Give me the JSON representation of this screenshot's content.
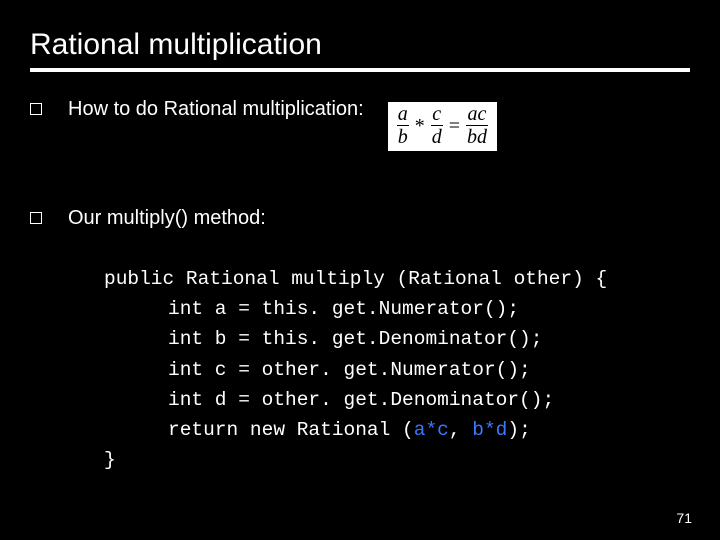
{
  "title": "Rational multiplication",
  "bullets": [
    "How to do Rational multiplication:",
    "Our multiply() method:"
  ],
  "formula": {
    "frac1_num": "a",
    "frac1_den": "b",
    "op1": "*",
    "frac2_num": "c",
    "frac2_den": "d",
    "op2": "=",
    "frac3_num": "ac",
    "frac3_den": "bd"
  },
  "code": {
    "l1a": "public Rational multiply (Rational other) {",
    "l2a": "int a = this. get.Numerator();",
    "l3a": "int b = this. get.Denominator();",
    "l4a": "int c = other. get.Numerator();",
    "l5a": "int d = other. get.Denominator();",
    "l6a": "return new Rational (",
    "l6b": "a*c",
    "l6c": ", ",
    "l6d": "b*d",
    "l6e": ");",
    "l7a": "}"
  },
  "page_number": "71"
}
